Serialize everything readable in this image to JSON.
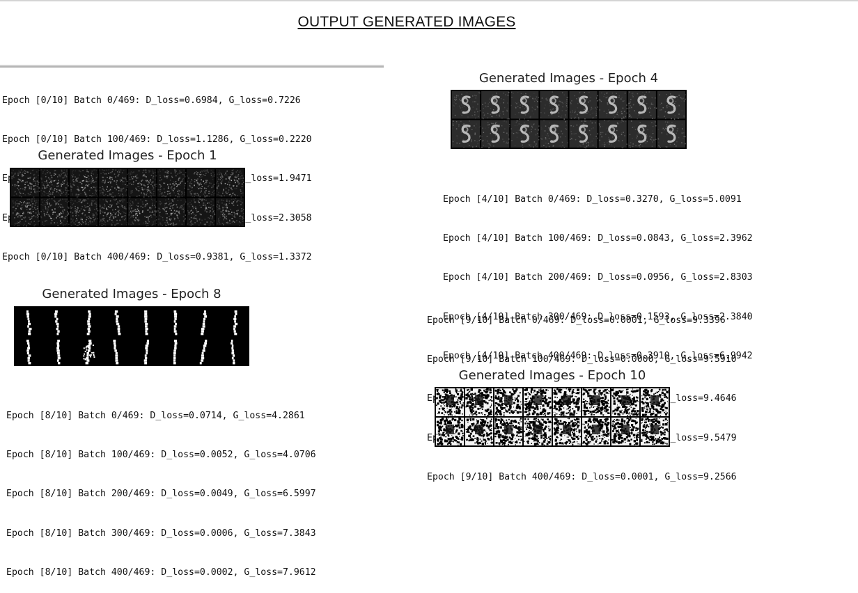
{
  "page": {
    "title": "OUTPUT GENERATED IMAGES"
  },
  "sections": {
    "epoch1": {
      "log_lines": [
        "Epoch [0/10] Batch 0/469: D_loss=0.6984, G_loss=0.7226",
        "Epoch [0/10] Batch 100/469: D_loss=1.1286, G_loss=0.2220",
        "Epoch [0/10] Batch 200/469: D_loss=0.1944, G_loss=1.9471",
        "Epoch [0/10] Batch 300/469: D_loss=0.3130, G_loss=2.3058",
        "Epoch [0/10] Batch 400/469: D_loss=0.9381, G_loss=1.3372"
      ],
      "grid_title": "Generated Images - Epoch 1"
    },
    "epoch4": {
      "grid_title": "Generated Images - Epoch 4",
      "log_lines": [
        "Epoch [4/10] Batch 0/469: D_loss=0.3270, G_loss=5.0091",
        "Epoch [4/10] Batch 100/469: D_loss=0.0843, G_loss=2.3962",
        "Epoch [4/10] Batch 200/469: D_loss=0.0956, G_loss=2.8303",
        "Epoch [4/10] Batch 300/469: D_loss=0.1593, G_loss=2.3840",
        "Epoch [4/10] Batch 400/469: D_loss=0.3910, G_loss=6.9942"
      ]
    },
    "epoch8": {
      "grid_title": "Generated Images - Epoch 8",
      "log_lines": [
        "Epoch [8/10] Batch 0/469: D_loss=0.0714, G_loss=4.2861",
        "Epoch [8/10] Batch 100/469: D_loss=0.0052, G_loss=4.0706",
        "Epoch [8/10] Batch 200/469: D_loss=0.0049, G_loss=6.5997",
        "Epoch [8/10] Batch 300/469: D_loss=0.0006, G_loss=7.3843",
        "Epoch [8/10] Batch 400/469: D_loss=0.0002, G_loss=7.9612"
      ]
    },
    "epoch10": {
      "log_lines": [
        "Epoch [9/10] Batch 0/469: D_loss=0.0001, G_loss=9.3396",
        "Epoch [9/10] Batch 100/469: D_loss=0.0000, G_loss=9.5910",
        "Epoch [9/10] Batch 200/469: D_loss=0.0000, G_loss=9.4646",
        "Epoch [9/10] Batch 300/469: D_loss=0.0000, G_loss=9.5479",
        "Epoch [9/10] Batch 400/469: D_loss=0.0001, G_loss=9.2566"
      ],
      "grid_title": "Generated Images - Epoch 10"
    }
  }
}
